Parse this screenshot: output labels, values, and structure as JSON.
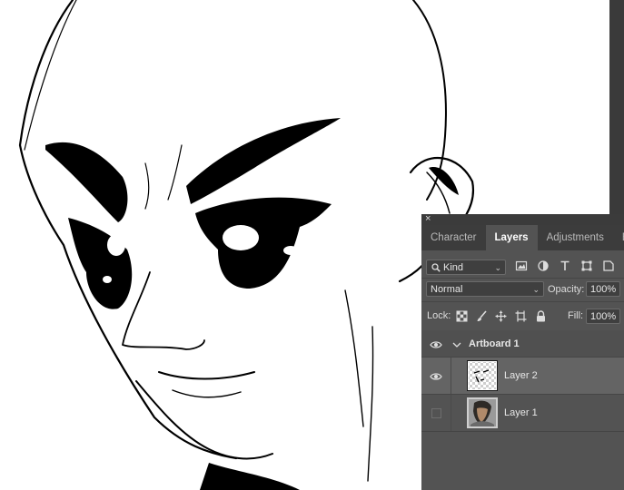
{
  "panel": {
    "close_glyph": "×",
    "tabs": [
      {
        "label": "Character",
        "active": false
      },
      {
        "label": "Layers",
        "active": true
      },
      {
        "label": "Adjustments",
        "active": false
      },
      {
        "label": "Br",
        "active": false
      }
    ],
    "filter": {
      "kind_label": "Kind"
    },
    "blend": {
      "mode": "Normal",
      "opacity_label": "Opacity:",
      "opacity_value": "100%"
    },
    "lock": {
      "label": "Lock:",
      "fill_label": "Fill:",
      "fill_value": "100%"
    },
    "layers": [
      {
        "name": "Artboard 1",
        "type": "artboard",
        "visible": true,
        "expanded": true
      },
      {
        "name": "Layer 2",
        "type": "layer",
        "visible": true,
        "selected": true
      },
      {
        "name": "Layer 1",
        "type": "layer",
        "visible": false,
        "selected": false
      }
    ]
  },
  "colors": {
    "panel_bg": "#535353",
    "tab_bar": "#3c3c3c",
    "selected_row": "#646464"
  },
  "icons": [
    "search-icon",
    "image-filter-icon",
    "adjustment-filter-icon",
    "type-filter-icon",
    "shape-filter-icon",
    "smart-object-filter-icon",
    "lock-transparent-icon",
    "lock-paint-icon",
    "lock-move-icon",
    "lock-artboard-icon",
    "lock-all-icon",
    "eye-icon",
    "chevron-down-icon"
  ]
}
